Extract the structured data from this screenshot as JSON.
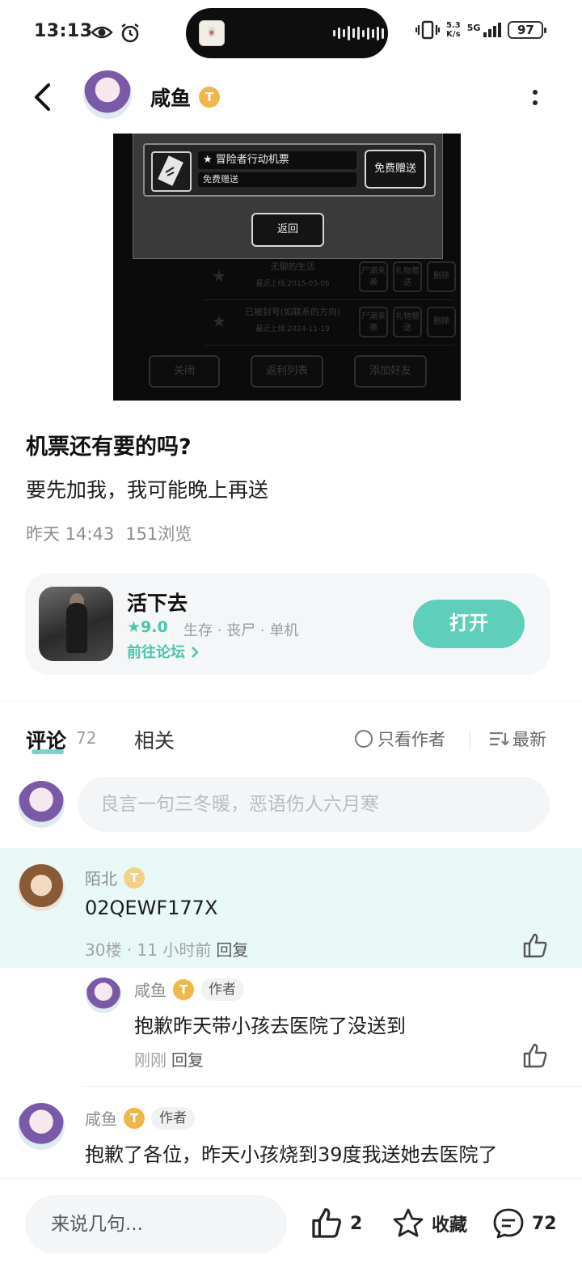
{
  "status_bar": {
    "time": "13:13",
    "net_speed_top": "5.3",
    "net_speed_bottom": "K/s",
    "network": "5G",
    "battery": "97"
  },
  "header": {
    "username": "咸鱼",
    "badge": "T"
  },
  "screenshot": {
    "item_name": "★ 冒险者行动机票",
    "item_sub": "免费赠送",
    "gift_button": "免费赠送",
    "return_button": "返回",
    "bg_rows": [
      {
        "title": "无聊的生活",
        "date": "最近上线:2015-03-06",
        "b1": "尸潮来袭",
        "b2": "礼物赠送",
        "b3": "删除"
      },
      {
        "title": "已被封号(如联系的方向)",
        "date": "最近上线:2024-11-19",
        "b1": "尸潮来袭",
        "b2": "礼物赠送",
        "b3": "删除"
      }
    ],
    "close_button": "关闭",
    "list_button": "返利列表",
    "add_friend_button": "添加好友"
  },
  "post": {
    "title": "机票还有要的吗?",
    "body": "要先加我，我可能晚上再送",
    "time": "昨天 14:43",
    "views": "151浏览"
  },
  "game_card": {
    "name": "活下去",
    "score": "9.0",
    "tags": "生存 · 丧尸 · 单机",
    "forum_link": "前往论坛",
    "open_button": "打开"
  },
  "tabs": {
    "comments": "评论",
    "comment_count": "72",
    "related": "相关",
    "only_author": "只看作者",
    "sort": "最新"
  },
  "comment_input": {
    "placeholder": "良言一句三冬暖，恶语伤人六月寒"
  },
  "comments": [
    {
      "name": "陌北",
      "badge": "T",
      "text": "02QEWF177X",
      "floor_time": "30楼 · 11 小时前",
      "reply": "回复"
    },
    {
      "name": "咸鱼",
      "badge": "T",
      "author_tag": "作者",
      "text": "抱歉昨天带小孩去医院了没送到",
      "time": "刚刚",
      "reply": "回复"
    },
    {
      "name": "咸鱼",
      "badge": "T",
      "author_tag": "作者",
      "text": "抱歉了各位，昨天小孩烧到39度我送她去医院了"
    }
  ],
  "bottom_bar": {
    "input_placeholder": "来说几句...",
    "likes": "2",
    "favorite": "收藏",
    "comments": "72"
  },
  "colors": {
    "accent": "#5ecfbb",
    "highlight_bg": "#e8f8f7",
    "badge": "#f0b64a"
  }
}
